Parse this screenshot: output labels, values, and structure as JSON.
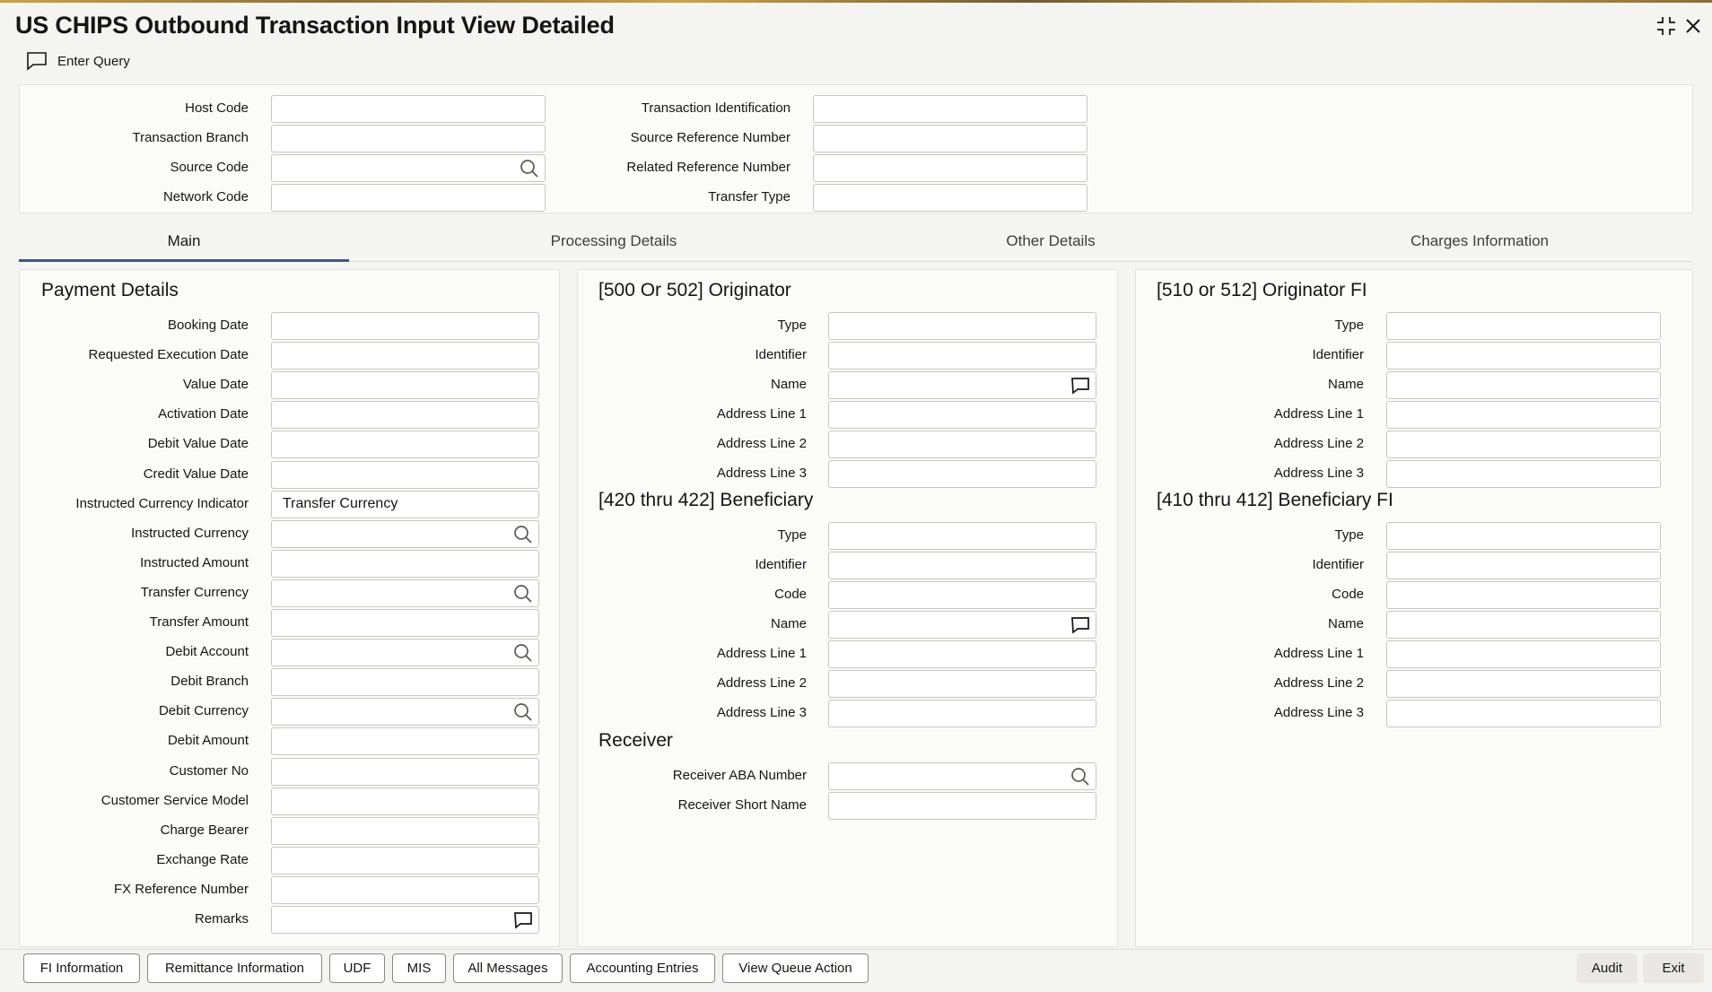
{
  "window": {
    "title": "US CHIPS Outbound Transaction Input View Detailed"
  },
  "toolbar": {
    "enter_query_label": "Enter Query"
  },
  "header_fields": {
    "host_code_label": "Host Code",
    "transaction_branch_label": "Transaction Branch",
    "source_code_label": "Source Code",
    "network_code_label": "Network Code",
    "transaction_identification_label": "Transaction Identification",
    "source_reference_number_label": "Source Reference Number",
    "related_reference_number_label": "Related Reference Number",
    "transfer_type_label": "Transfer Type"
  },
  "tabs": [
    {
      "label": "Main",
      "active": true
    },
    {
      "label": "Processing Details",
      "active": false
    },
    {
      "label": "Other Details",
      "active": false
    },
    {
      "label": "Charges Information",
      "active": false
    }
  ],
  "payment_details": {
    "heading": "Payment Details",
    "fields": [
      {
        "label": "Booking Date",
        "value": "",
        "icon": ""
      },
      {
        "label": "Requested Execution Date",
        "value": "",
        "icon": ""
      },
      {
        "label": "Value Date",
        "value": "",
        "icon": ""
      },
      {
        "label": "Activation Date",
        "value": "",
        "icon": ""
      },
      {
        "label": "Debit Value Date",
        "value": "",
        "icon": ""
      },
      {
        "label": "Credit Value Date",
        "value": "",
        "icon": ""
      },
      {
        "label": "Instructed Currency Indicator",
        "value": "Transfer Currency",
        "icon": ""
      },
      {
        "label": "Instructed Currency",
        "value": "",
        "icon": "search-icon"
      },
      {
        "label": "Instructed Amount",
        "value": "",
        "icon": ""
      },
      {
        "label": "Transfer Currency",
        "value": "",
        "icon": "search-icon"
      },
      {
        "label": "Transfer Amount",
        "value": "",
        "icon": ""
      },
      {
        "label": "Debit Account",
        "value": "",
        "icon": "search-icon"
      },
      {
        "label": "Debit Branch",
        "value": "",
        "icon": ""
      },
      {
        "label": "Debit Currency",
        "value": "",
        "icon": "search-icon"
      },
      {
        "label": "Debit Amount",
        "value": "",
        "icon": ""
      },
      {
        "label": "Customer No",
        "value": "",
        "icon": ""
      },
      {
        "label": "Customer Service Model",
        "value": "",
        "icon": ""
      },
      {
        "label": "Charge Bearer",
        "value": "",
        "icon": ""
      },
      {
        "label": "Exchange Rate",
        "value": "",
        "icon": ""
      },
      {
        "label": "FX Reference Number",
        "value": "",
        "icon": ""
      },
      {
        "label": "Remarks",
        "value": "",
        "icon": "comment-icon"
      }
    ]
  },
  "originator": {
    "heading": "[500 Or 502] Originator",
    "fields": [
      {
        "label": "Type",
        "icon": ""
      },
      {
        "label": "Identifier",
        "icon": ""
      },
      {
        "label": "Name",
        "icon": "comment-icon"
      },
      {
        "label": "Address Line 1",
        "icon": ""
      },
      {
        "label": "Address Line 2",
        "icon": ""
      },
      {
        "label": "Address Line 3",
        "icon": ""
      }
    ]
  },
  "beneficiary": {
    "heading": "[420 thru 422] Beneficiary",
    "fields": [
      {
        "label": "Type",
        "icon": ""
      },
      {
        "label": "Identifier",
        "icon": ""
      },
      {
        "label": "Code",
        "icon": ""
      },
      {
        "label": "Name",
        "icon": "comment-icon"
      },
      {
        "label": "Address Line 1",
        "icon": ""
      },
      {
        "label": "Address Line 2",
        "icon": ""
      },
      {
        "label": "Address Line 3",
        "icon": ""
      }
    ]
  },
  "receiver": {
    "heading": "Receiver",
    "fields": [
      {
        "label": "Receiver ABA Number",
        "icon": "search-icon"
      },
      {
        "label": "Receiver Short Name",
        "icon": ""
      }
    ]
  },
  "originator_fi": {
    "heading": "[510 or 512] Originator FI",
    "fields": [
      {
        "label": "Type"
      },
      {
        "label": "Identifier"
      },
      {
        "label": "Name"
      },
      {
        "label": "Address Line 1"
      },
      {
        "label": "Address Line 2"
      },
      {
        "label": "Address Line 3"
      }
    ]
  },
  "beneficiary_fi": {
    "heading": "[410 thru 412] Beneficiary FI",
    "fields": [
      {
        "label": "Type"
      },
      {
        "label": "Identifier"
      },
      {
        "label": "Code"
      },
      {
        "label": "Name"
      },
      {
        "label": "Address Line 1"
      },
      {
        "label": "Address Line 2"
      },
      {
        "label": "Address Line 3"
      }
    ]
  },
  "footer": {
    "buttons": [
      "FI Information",
      "Remittance Information",
      "UDF",
      "MIS",
      "All Messages",
      "Accounting Entries",
      "View Queue Action"
    ],
    "audit_label": "Audit",
    "exit_label": "Exit"
  }
}
